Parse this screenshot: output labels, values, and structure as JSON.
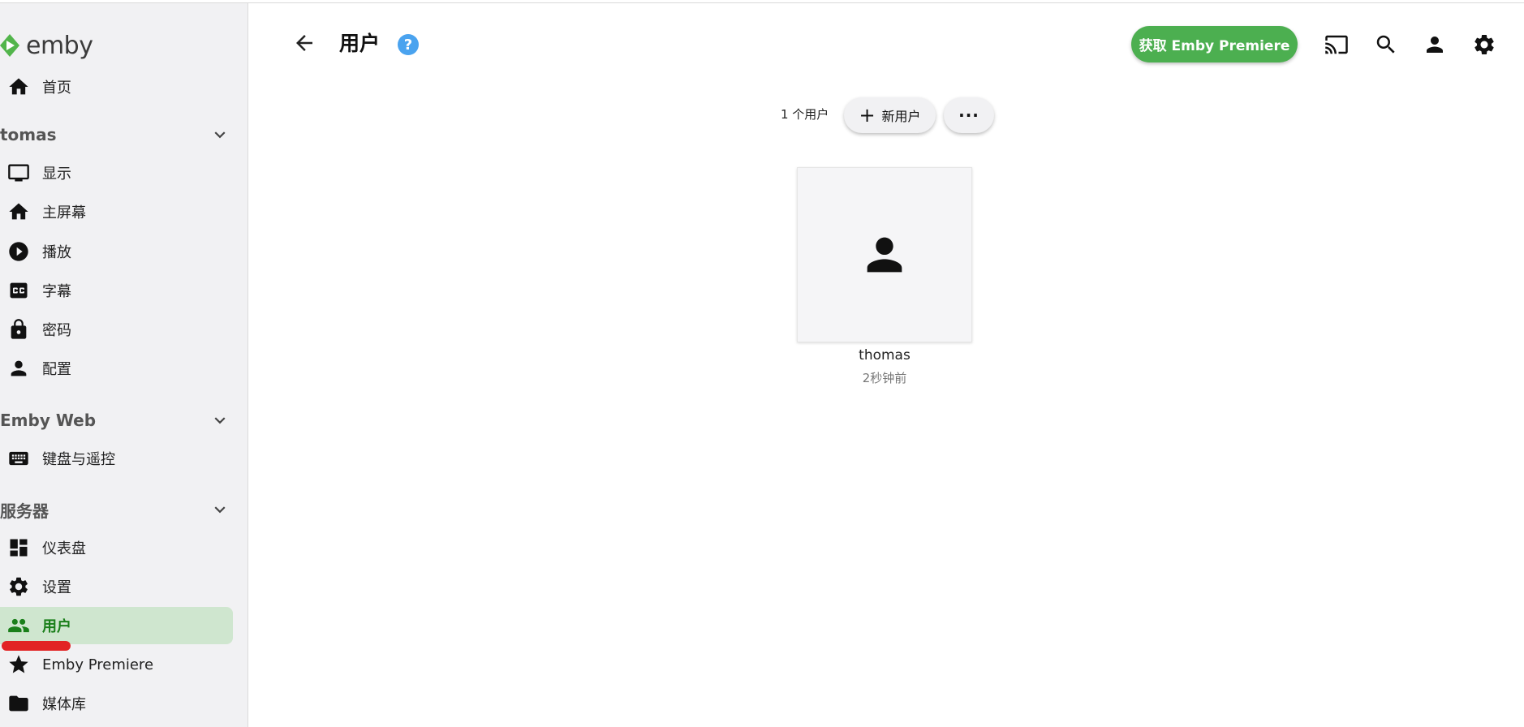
{
  "brand": {
    "logo_text": "emby",
    "logo_color": "#52b54b"
  },
  "sidebar": {
    "home": {
      "label": "首页",
      "icon": "home-icon"
    },
    "user_section": {
      "title": "tomas",
      "items": [
        {
          "label": "显示",
          "icon": "monitor-icon"
        },
        {
          "label": "主屏幕",
          "icon": "home-icon"
        },
        {
          "label": "播放",
          "icon": "play-circle-icon"
        },
        {
          "label": "字幕",
          "icon": "closed-caption-icon"
        },
        {
          "label": "密码",
          "icon": "lock-icon"
        },
        {
          "label": "配置",
          "icon": "person-icon"
        }
      ]
    },
    "web_section": {
      "title": "Emby Web",
      "items": [
        {
          "label": "键盘与遥控",
          "icon": "keyboard-icon"
        }
      ]
    },
    "server_section": {
      "title": "服务器",
      "items": [
        {
          "label": "仪表盘",
          "icon": "dashboard-icon"
        },
        {
          "label": "设置",
          "icon": "gear-icon"
        },
        {
          "label": "用户",
          "icon": "people-icon",
          "active": true
        },
        {
          "label": "Emby Premiere",
          "icon": "star-icon"
        },
        {
          "label": "媒体库",
          "icon": "folder-icon"
        }
      ]
    },
    "active_color": "#1a7f1a",
    "active_bg": "#cfe6cf"
  },
  "header": {
    "title": "用户",
    "help_label": "?",
    "premiere_button": "获取 Emby Premiere",
    "premiere_color": "#4caf50",
    "icons": [
      "cast-icon",
      "search-icon",
      "account-icon",
      "gear-icon"
    ]
  },
  "toolbar": {
    "user_count": "1 个用户",
    "new_user_label": "新用户",
    "more_label": "···"
  },
  "users": [
    {
      "name": "thomas",
      "last_seen": "2秒钟前"
    }
  ]
}
